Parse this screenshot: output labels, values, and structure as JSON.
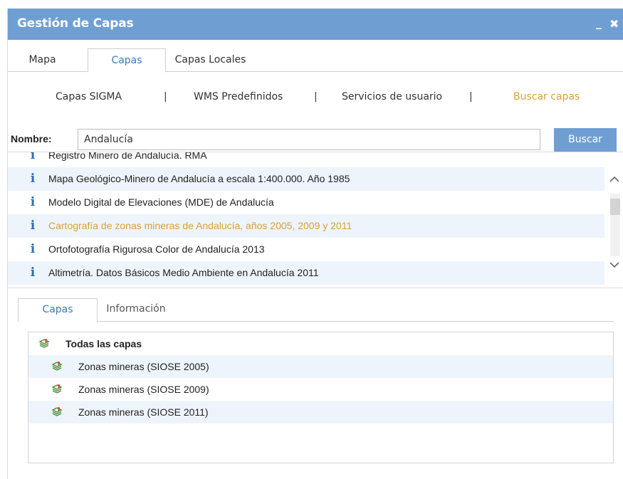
{
  "window": {
    "title": "Gestión de Capas",
    "minimize_glyph": "_",
    "close_glyph": "✖"
  },
  "top_tabs": [
    {
      "label": "Mapa",
      "active": false
    },
    {
      "label": "Capas",
      "active": true
    },
    {
      "label": "Capas Locales",
      "active": false
    }
  ],
  "sublinks": {
    "items": [
      "Capas SIGMA",
      "WMS Predefinidos",
      "Servicios de usuario",
      "Buscar capas"
    ],
    "separator": "|",
    "active": "Buscar capas"
  },
  "search": {
    "label": "Nombre:",
    "value": "Andalucía",
    "button": "Buscar"
  },
  "results": [
    {
      "label": "Registro Minero de Andalucía. RMA",
      "highlighted": false
    },
    {
      "label": "Mapa Geológico-Minero de Andalucía a escala 1:400.000. Año 1985",
      "highlighted": false
    },
    {
      "label": "Modelo Digital de Elevaciones (MDE) de Andalucía",
      "highlighted": false
    },
    {
      "label": "Cartografía de zonas mineras de Andalucía, años 2005, 2009 y 2011",
      "highlighted": true
    },
    {
      "label": "Ortofotografía Rigurosa Color de Andalucía 2013",
      "highlighted": false
    },
    {
      "label": "Altimetría. Datos Básicos Medio Ambiente en Andalucía 2011",
      "highlighted": false
    }
  ],
  "info_glyph": "i",
  "bottom_tabs": [
    {
      "label": "Capas",
      "active": true
    },
    {
      "label": "Información",
      "active": false
    }
  ],
  "layers": {
    "root": "Todas las capas",
    "items": [
      "Zonas mineras (SIOSE 2005)",
      "Zonas mineras (SIOSE 2009)",
      "Zonas mineras (SIOSE 2011)"
    ]
  },
  "colors": {
    "titlebar": "#6f9fd2",
    "accent_text": "#3d7ab8",
    "highlight": "#d9a03a",
    "row_alt": "#eef4fb",
    "info_icon": "#2e6db4"
  }
}
